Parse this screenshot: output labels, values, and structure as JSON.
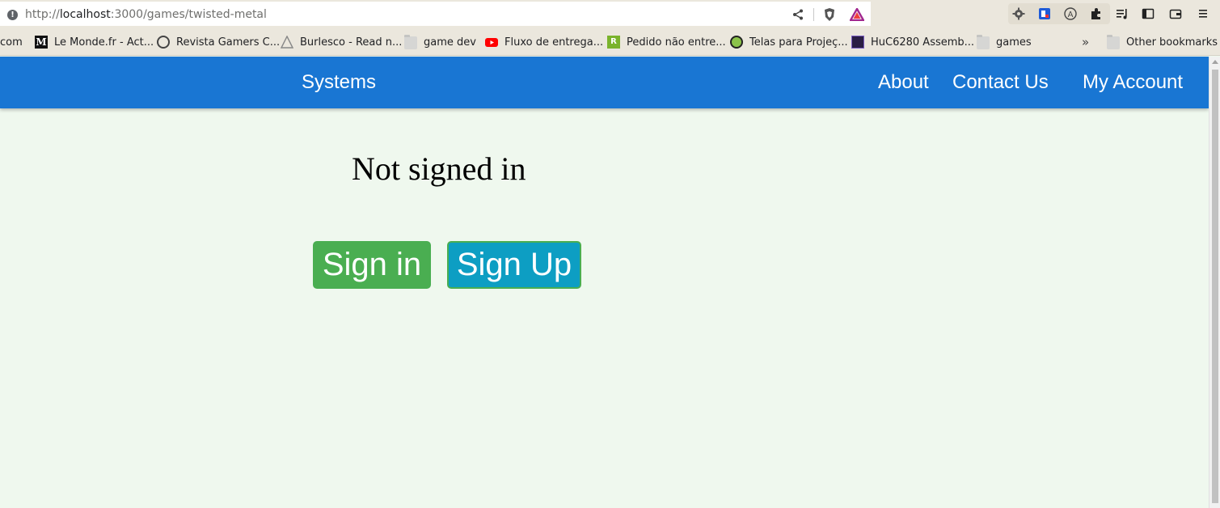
{
  "browser": {
    "url_scheme": "http://",
    "url_host": "localhost",
    "url_path": ":3000/games/twisted-metal",
    "other_bookmarks_label": "Other bookmarks",
    "overflow_label": "»"
  },
  "bookmarks": [
    {
      "label": "com",
      "icon": "none"
    },
    {
      "label": "Le Monde.fr - Act...",
      "icon": "lemonde-icon"
    },
    {
      "label": "Revista Gamers C...",
      "icon": "revista-icon"
    },
    {
      "label": "Burlesco - Read n...",
      "icon": "burlesco-icon"
    },
    {
      "label": "game dev",
      "icon": "folder-icon"
    },
    {
      "label": "Fluxo de entrega...",
      "icon": "youtube-icon"
    },
    {
      "label": "Pedido não entre...",
      "icon": "pedido-icon"
    },
    {
      "label": "Telas para Projeç...",
      "icon": "telas-icon"
    },
    {
      "label": "HuC6280 Assemb...",
      "icon": "huc-icon"
    },
    {
      "label": "games",
      "icon": "folder-icon"
    }
  ],
  "navbar": {
    "systems": "Systems",
    "about": "About",
    "contact": "Contact Us",
    "account": "My Account",
    "color": "#1976d3"
  },
  "main": {
    "title": "Not signed in",
    "signin_label": "Sign in",
    "signup_label": "Sign Up",
    "signin_color": "#4aae51",
    "signup_color": "#0d9ec3",
    "background": "#eff8ee"
  }
}
